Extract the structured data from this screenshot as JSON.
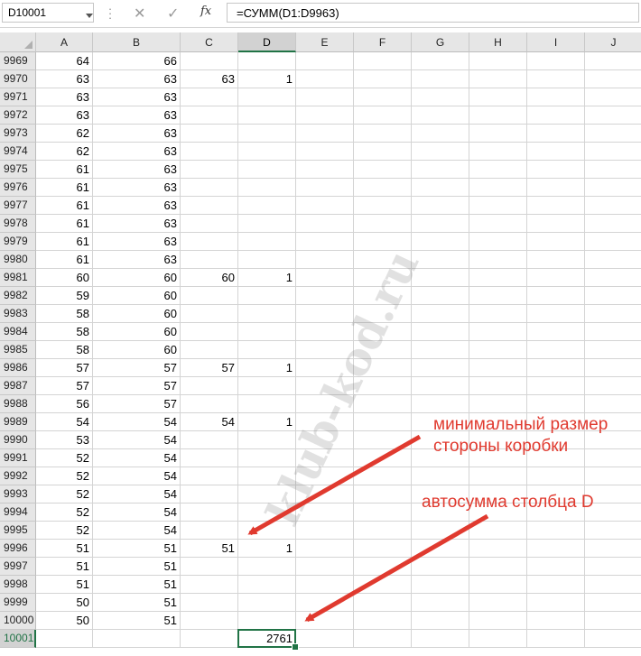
{
  "formula_bar": {
    "name_box": "D10001",
    "cancel_glyph": "✕",
    "enter_glyph": "✓",
    "fx_label": "fx",
    "formula": "=СУММ(D1:D9963)"
  },
  "columns": [
    "A",
    "B",
    "C",
    "D",
    "E",
    "F",
    "G",
    "H",
    "I",
    "J"
  ],
  "selected_column": "D",
  "rows": [
    {
      "n": "9969",
      "A": "64",
      "B": "66",
      "C": "",
      "D": ""
    },
    {
      "n": "9970",
      "A": "63",
      "B": "63",
      "C": "63",
      "D": "1"
    },
    {
      "n": "9971",
      "A": "63",
      "B": "63",
      "C": "",
      "D": ""
    },
    {
      "n": "9972",
      "A": "63",
      "B": "63",
      "C": "",
      "D": ""
    },
    {
      "n": "9973",
      "A": "62",
      "B": "63",
      "C": "",
      "D": ""
    },
    {
      "n": "9974",
      "A": "62",
      "B": "63",
      "C": "",
      "D": ""
    },
    {
      "n": "9975",
      "A": "61",
      "B": "63",
      "C": "",
      "D": ""
    },
    {
      "n": "9976",
      "A": "61",
      "B": "63",
      "C": "",
      "D": ""
    },
    {
      "n": "9977",
      "A": "61",
      "B": "63",
      "C": "",
      "D": ""
    },
    {
      "n": "9978",
      "A": "61",
      "B": "63",
      "C": "",
      "D": ""
    },
    {
      "n": "9979",
      "A": "61",
      "B": "63",
      "C": "",
      "D": ""
    },
    {
      "n": "9980",
      "A": "61",
      "B": "63",
      "C": "",
      "D": ""
    },
    {
      "n": "9981",
      "A": "60",
      "B": "60",
      "C": "60",
      "D": "1"
    },
    {
      "n": "9982",
      "A": "59",
      "B": "60",
      "C": "",
      "D": ""
    },
    {
      "n": "9983",
      "A": "58",
      "B": "60",
      "C": "",
      "D": ""
    },
    {
      "n": "9984",
      "A": "58",
      "B": "60",
      "C": "",
      "D": ""
    },
    {
      "n": "9985",
      "A": "58",
      "B": "60",
      "C": "",
      "D": ""
    },
    {
      "n": "9986",
      "A": "57",
      "B": "57",
      "C": "57",
      "D": "1"
    },
    {
      "n": "9987",
      "A": "57",
      "B": "57",
      "C": "",
      "D": ""
    },
    {
      "n": "9988",
      "A": "56",
      "B": "57",
      "C": "",
      "D": ""
    },
    {
      "n": "9989",
      "A": "54",
      "B": "54",
      "C": "54",
      "D": "1"
    },
    {
      "n": "9990",
      "A": "53",
      "B": "54",
      "C": "",
      "D": ""
    },
    {
      "n": "9991",
      "A": "52",
      "B": "54",
      "C": "",
      "D": ""
    },
    {
      "n": "9992",
      "A": "52",
      "B": "54",
      "C": "",
      "D": ""
    },
    {
      "n": "9993",
      "A": "52",
      "B": "54",
      "C": "",
      "D": ""
    },
    {
      "n": "9994",
      "A": "52",
      "B": "54",
      "C": "",
      "D": ""
    },
    {
      "n": "9995",
      "A": "52",
      "B": "54",
      "C": "",
      "D": ""
    },
    {
      "n": "9996",
      "A": "51",
      "B": "51",
      "C": "51",
      "D": "1"
    },
    {
      "n": "9997",
      "A": "51",
      "B": "51",
      "C": "",
      "D": ""
    },
    {
      "n": "9998",
      "A": "51",
      "B": "51",
      "C": "",
      "D": ""
    },
    {
      "n": "9999",
      "A": "50",
      "B": "51",
      "C": "",
      "D": ""
    },
    {
      "n": "10000",
      "A": "50",
      "B": "51",
      "C": "",
      "D": ""
    },
    {
      "n": "10001",
      "A": "",
      "B": "",
      "C": "",
      "D": "2761",
      "selected": true
    }
  ],
  "watermark": "klub-kod.ru",
  "annotations": {
    "min_size_note_line1": "минимальный размер",
    "min_size_note_line2": "стороны коробки",
    "autosum_note": "автосумма столбца D"
  },
  "colors": {
    "accent_green": "#217346",
    "annotation_red": "#e03a2f"
  }
}
